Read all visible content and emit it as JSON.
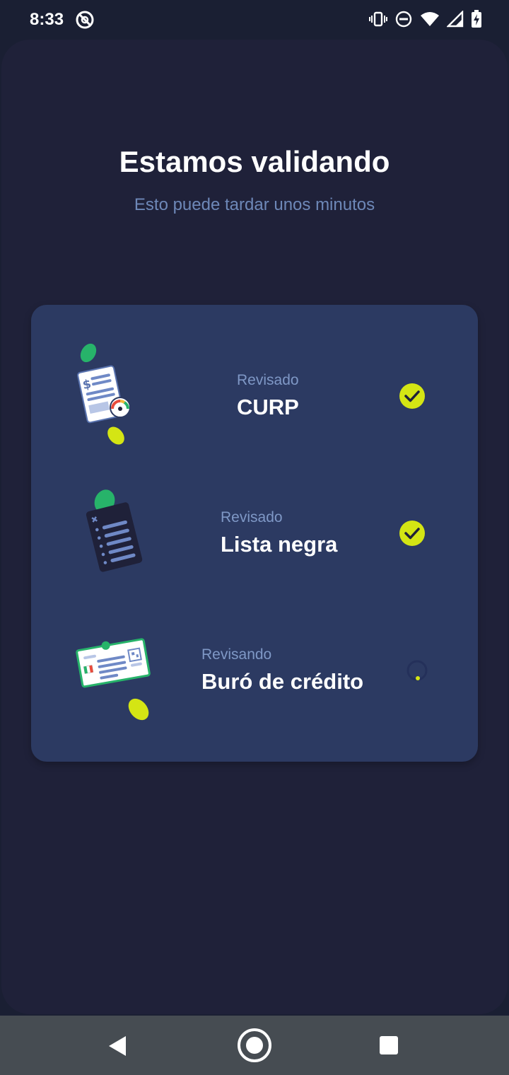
{
  "status_bar": {
    "time": "8:33",
    "icons": [
      "at-sign-icon",
      "vibrate-icon",
      "do-not-disturb-icon",
      "wifi-icon",
      "signal-icon",
      "battery-charging-icon"
    ]
  },
  "header": {
    "title": "Estamos validando",
    "subtitle": "Esto puede tardar unos minutos"
  },
  "checks": [
    {
      "caption": "Revisado",
      "label": "CURP",
      "status": "done",
      "illustration": "document-gauge-illustration"
    },
    {
      "caption": "Revisado",
      "label": "Lista negra",
      "status": "done",
      "illustration": "checklist-illustration"
    },
    {
      "caption": "Revisando",
      "label": "Buró de crédito",
      "status": "loading",
      "illustration": "id-card-illustration"
    }
  ],
  "nav_bar": {
    "buttons": [
      "back-icon",
      "home-icon",
      "recents-icon"
    ]
  },
  "colors": {
    "background": "#1f2139",
    "card": "#2c3a62",
    "accent_yellow": "#d4e514",
    "accent_green": "#27b36a",
    "caption": "#7f98c6"
  }
}
